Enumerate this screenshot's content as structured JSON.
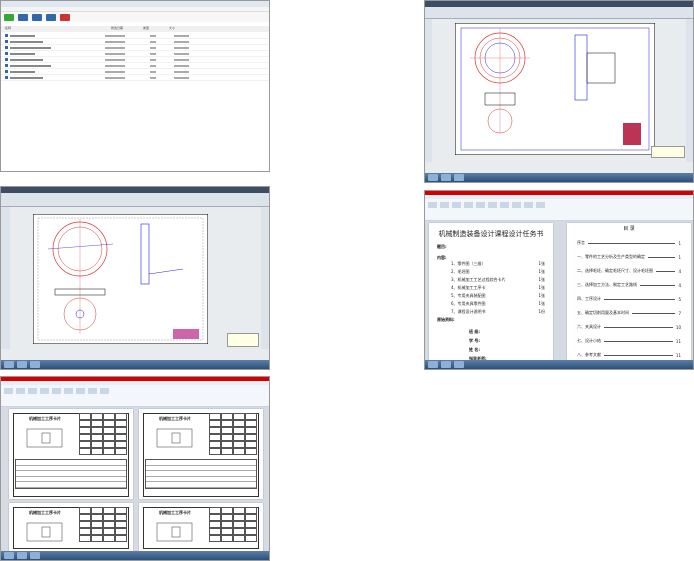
{
  "explorer": {
    "columns": [
      "名称",
      "修改日期",
      "类型",
      "大小"
    ],
    "row_count": 8
  },
  "doc": {
    "title": "机械制造装备设计课程设计任务书",
    "subject_label": "题目:",
    "content_label": "内容:",
    "items": [
      {
        "text": "1、零件图（三维）",
        "count": "1张"
      },
      {
        "text": "2、毛坯图",
        "count": "1张"
      },
      {
        "text": "3、机械加工工艺过程综合卡片",
        "count": "1张"
      },
      {
        "text": "4、机械加工工序卡",
        "count": "1张"
      },
      {
        "text": "5、专用夹具装配图",
        "count": "1张"
      },
      {
        "text": "6、专用夹具零件图",
        "count": "1张"
      },
      {
        "text": "7、课程设计说明书",
        "count": "1份"
      }
    ],
    "source_label": "原始资料:",
    "signatures": [
      "班  级:",
      "学  号:",
      "姓  名:",
      "指导老师:"
    ],
    "toc_heading": "目 录",
    "toc": [
      {
        "text": "序言",
        "page": "1"
      },
      {
        "text": "一、零件的工艺分析及生产类型的确定",
        "page": "1"
      },
      {
        "text": "二、选择毛坯、确定毛坯尺寸、设计毛坯图",
        "page": "4"
      },
      {
        "text": "三、选择加工方法、制定工艺路线",
        "page": "4"
      },
      {
        "text": "四、工序设计",
        "page": "5"
      },
      {
        "text": "五、确定切削用量及基本时间",
        "page": "7"
      },
      {
        "text": "六、夹具设计",
        "page": "10"
      },
      {
        "text": "七、设计小结",
        "page": "11"
      },
      {
        "text": "八、参考文献",
        "page": "11"
      }
    ]
  },
  "card": {
    "title": "机械加工工序卡片"
  },
  "colors": {
    "cad_bg": "#e9ecef",
    "word_title": "#d40000",
    "taskbar": "#2c4f7a",
    "cad_red": "#d33",
    "cad_blue": "#22d"
  }
}
